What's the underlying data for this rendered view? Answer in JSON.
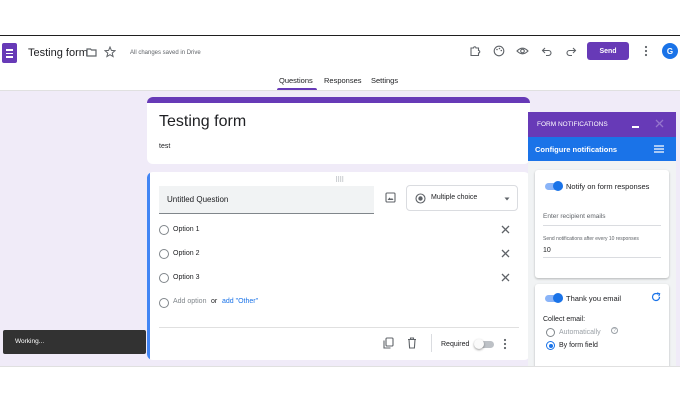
{
  "header": {
    "form_title": "Testing form",
    "save_status": "All changes saved in Drive",
    "send_label": "Send",
    "avatar_initial": "G",
    "icons": [
      "form-logo-icon",
      "folder-icon",
      "star-icon",
      "addon-puzzle-icon",
      "palette-icon",
      "preview-eye-icon",
      "undo-icon",
      "redo-icon",
      "more-vert-icon"
    ]
  },
  "tabs": [
    {
      "label": "Questions",
      "active": true
    },
    {
      "label": "Responses",
      "active": false
    },
    {
      "label": "Settings",
      "active": false
    }
  ],
  "form": {
    "title": "Testing form",
    "description": "test"
  },
  "question": {
    "title": "Untitled Question",
    "type": "Multiple choice",
    "options": [
      "Option 1",
      "Option 2",
      "Option 3"
    ],
    "add_option": "Add option",
    "or_text": "or",
    "add_other": "add \"Other\"",
    "required_label": "Required",
    "required": false
  },
  "toast": {
    "text": "Working..."
  },
  "notifications": {
    "panel_title": "FORM NOTIFICATIONS",
    "config_title": "Configure notifications",
    "notify_label": "Notify on form responses",
    "notify_enabled": true,
    "recipient_placeholder": "Enter recipient emails",
    "frequency_label": "Send notifications after every 10 responses",
    "frequency_value": "10",
    "thank_label": "Thank you email",
    "thank_enabled": true,
    "collect_label": "Collect email:",
    "collect_options": [
      {
        "label": "Automatically",
        "selected": false
      },
      {
        "label": "By form field",
        "selected": true
      }
    ]
  },
  "colors": {
    "accent": "#673ab7",
    "background": "#f0ebf8",
    "blue": "#1a73e8"
  }
}
